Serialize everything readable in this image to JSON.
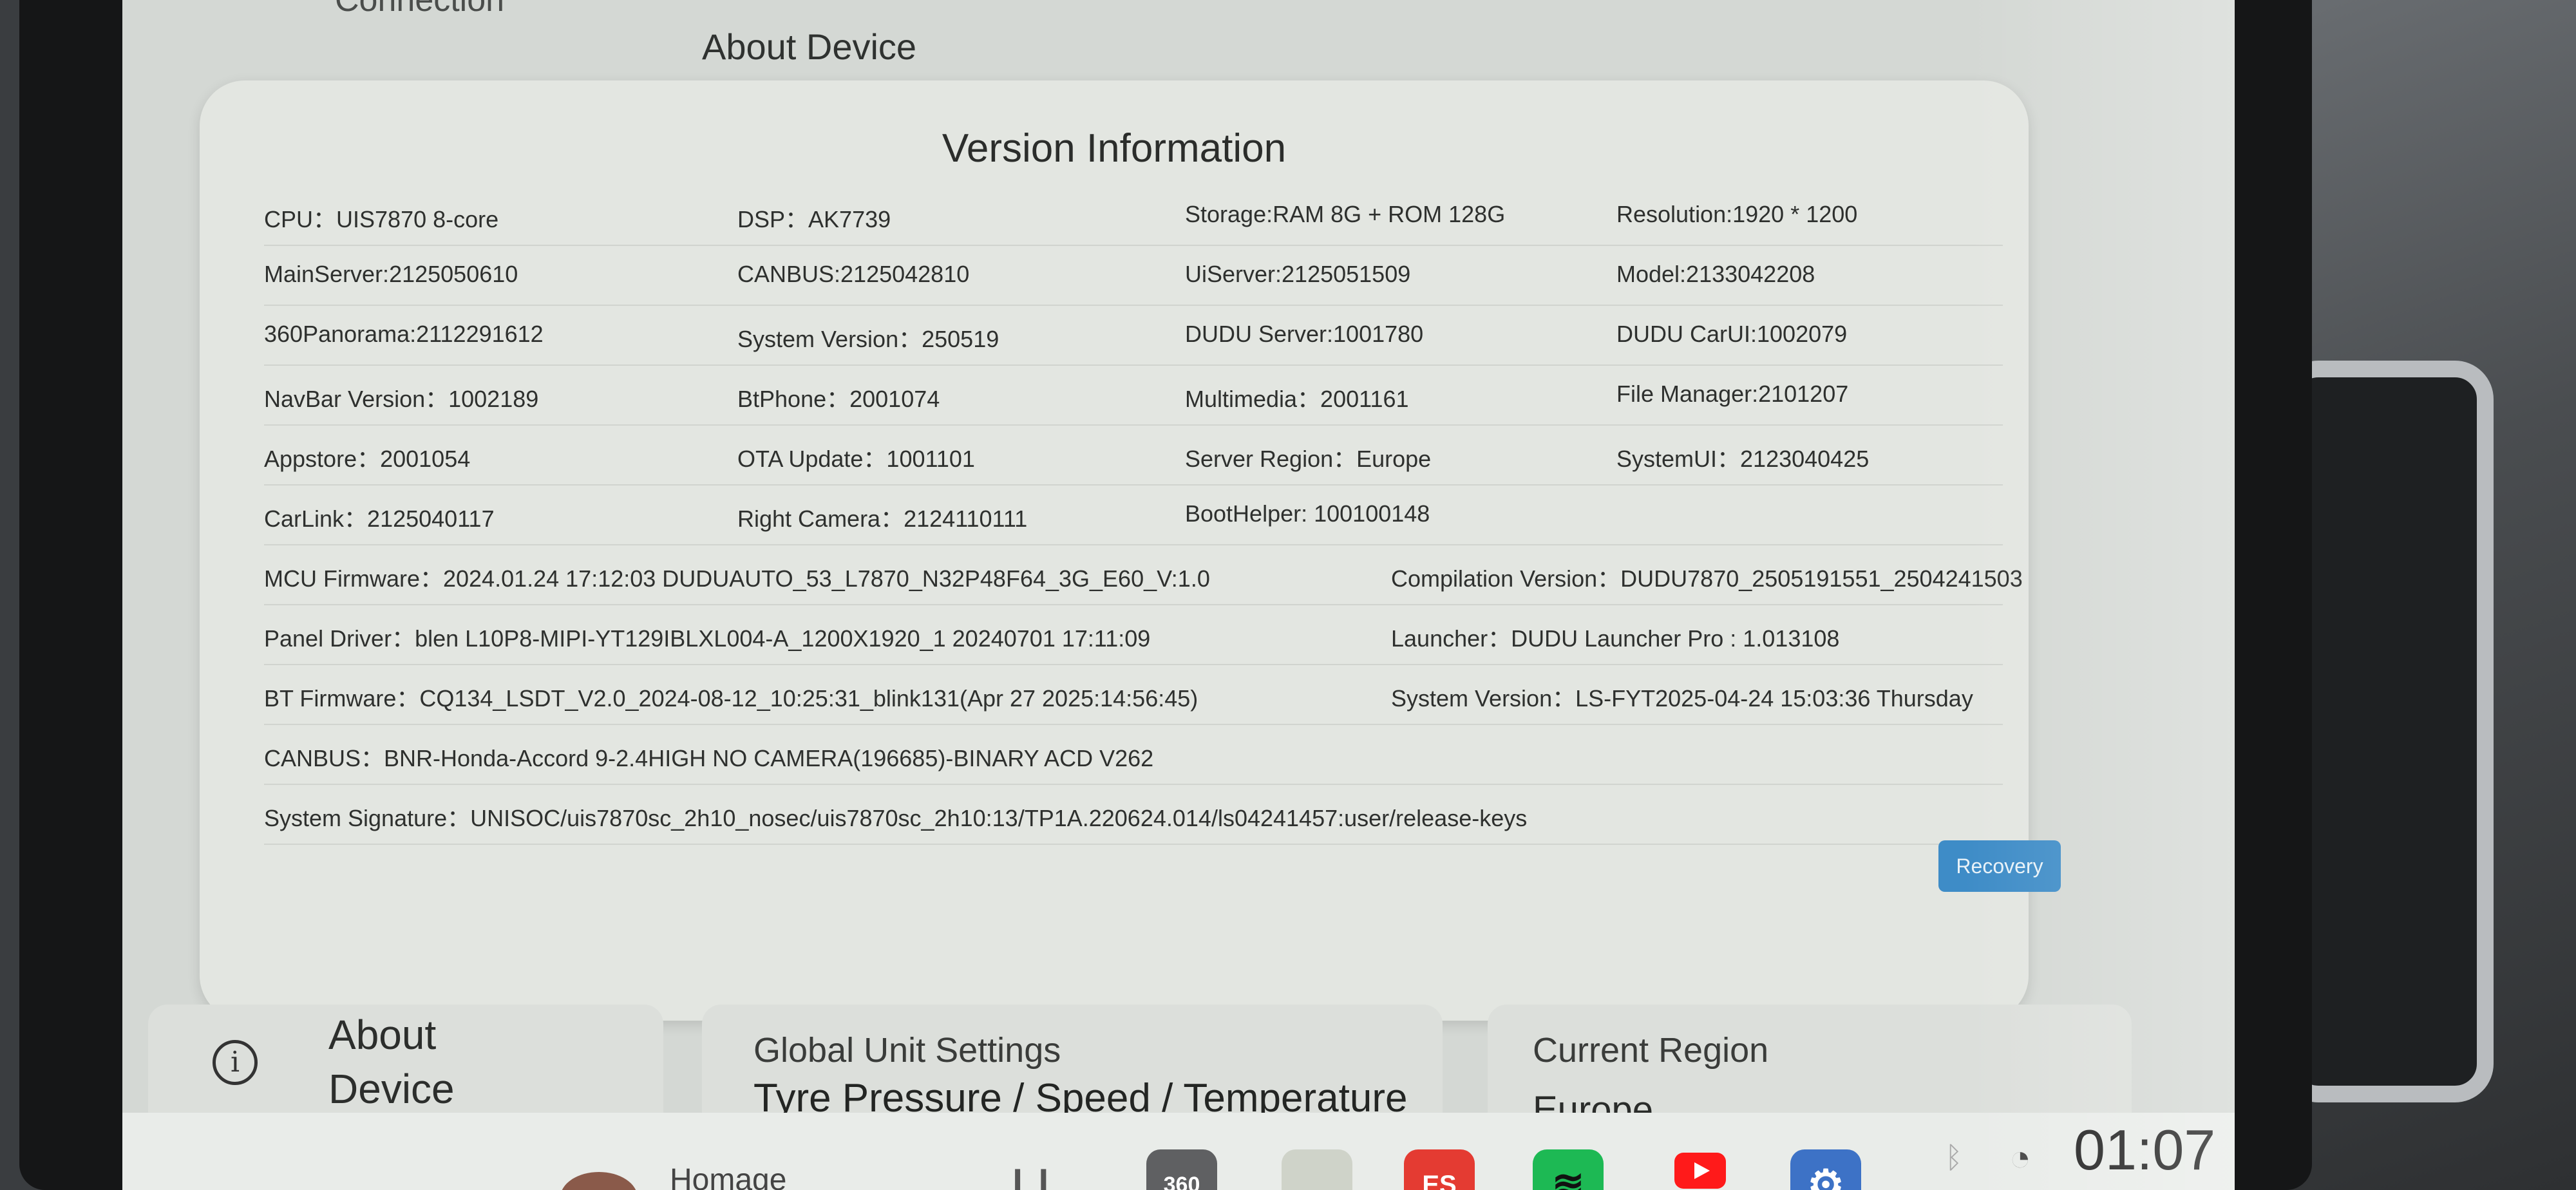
{
  "header": {
    "connection_label": "Connection",
    "section_title": "About Device"
  },
  "panel": {
    "title": "Version Information",
    "rows": [
      [
        "CPU：UIS7870 8-core",
        "DSP：AK7739",
        "Storage:RAM 8G + ROM 128G",
        "Resolution:1920 * 1200"
      ],
      [
        "MainServer:2125050610",
        "CANBUS:2125042810",
        "UiServer:2125051509",
        "Model:2133042208"
      ],
      [
        "360Panorama:2112291612",
        "System Version：250519",
        "DUDU Server:1001780",
        "DUDU CarUI:1002079"
      ],
      [
        "NavBar Version：1002189",
        "BtPhone：2001074",
        "Multimedia：2001161",
        "File Manager:2101207"
      ],
      [
        "Appstore：2001054",
        "OTA Update：1001101",
        "Server Region：Europe",
        "SystemUI：2123040425"
      ],
      [
        "CarLink：2125040117",
        "Right Camera：2124110111",
        "BootHelper: 100100148",
        ""
      ]
    ],
    "wide_rows": [
      [
        "MCU Firmware：2024.01.24 17:12:03 DUDUAUTO_53_L7870_N32P48F64_3G_E60_V:1.0",
        "Compilation Version：DUDU7870_2505191551_2504241503"
      ],
      [
        "Panel Driver：blen L10P8-MIPI-YT129IBLXL004-A_1200X1920_1 20240701 17:11:09",
        "Launcher：DUDU Launcher Pro : 1.013108"
      ],
      [
        "BT Firmware：CQ134_LSDT_V2.0_2024-08-12_10:25:31_blink131(Apr 27 2025:14:56:45)",
        "System Version：LS-FYT2025-04-24 15:03:36 Thursday"
      ],
      [
        "CANBUS：BNR-Honda-Accord 9-2.4HIGH NO CAMERA(196685)-BINARY ACD V262",
        ""
      ],
      [
        "System Signature：UNISOC/uis7870sc_2h10_nosec/uis7870sc_2h10:13/TP1A.220624.014/ls04241457:user/release-keys",
        ""
      ]
    ],
    "recovery_label": "Recovery"
  },
  "cards": {
    "about_label": "About Device",
    "about_icon": "info-icon",
    "units_title": "Global Unit Settings",
    "units_sub": "Tyre Pressure / Speed / Temperature",
    "region_title": "Current Region",
    "region_value": "Europe"
  },
  "navbar": {
    "homage_label": "Homage",
    "app_360": "360",
    "app_es": "ES",
    "clock": "01:07",
    "icons": [
      "360-app-icon",
      "files-app-icon",
      "es-app-icon",
      "spotify-app-icon",
      "youtube-app-icon",
      "settings-app-icon",
      "bluetooth-icon",
      "wifi-icon"
    ]
  },
  "colors": {
    "accent_button": "#3e8cc7",
    "panel_bg": "#e3e6e1",
    "screen_bg": "#d4d8d4"
  }
}
